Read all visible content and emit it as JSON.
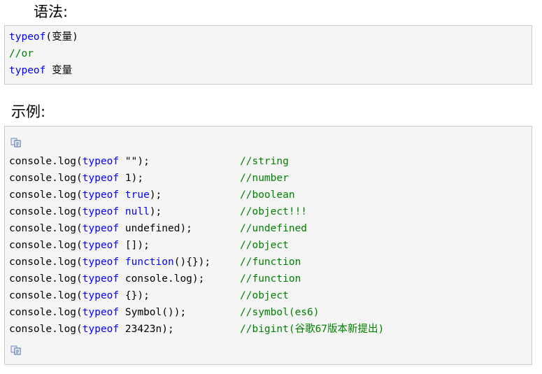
{
  "syntax": {
    "heading": "语法:",
    "lines": [
      [
        {
          "t": "typeof",
          "c": "kw"
        },
        {
          "t": "(变量)",
          "c": "pl"
        }
      ],
      [
        {
          "t": "//or",
          "c": "cm"
        }
      ],
      [
        {
          "t": "typeof",
          "c": "kw"
        },
        {
          "t": " 变量",
          "c": "pl"
        }
      ]
    ]
  },
  "example": {
    "heading": "示例:",
    "lines": [
      {
        "code": [
          {
            "t": "console.log(",
            "c": "pl"
          },
          {
            "t": "typeof",
            "c": "kw"
          },
          {
            "t": " \"\");",
            "c": "pl"
          }
        ],
        "comment": "//string"
      },
      {
        "code": [
          {
            "t": "console.log(",
            "c": "pl"
          },
          {
            "t": "typeof",
            "c": "kw"
          },
          {
            "t": " 1);",
            "c": "pl"
          }
        ],
        "comment": "//number"
      },
      {
        "code": [
          {
            "t": "console.log(",
            "c": "pl"
          },
          {
            "t": "typeof",
            "c": "kw"
          },
          {
            "t": " ",
            "c": "pl"
          },
          {
            "t": "true",
            "c": "kw"
          },
          {
            "t": ");",
            "c": "pl"
          }
        ],
        "comment": "//boolean"
      },
      {
        "code": [
          {
            "t": "console.log(",
            "c": "pl"
          },
          {
            "t": "typeof",
            "c": "kw"
          },
          {
            "t": " ",
            "c": "pl"
          },
          {
            "t": "null",
            "c": "kw"
          },
          {
            "t": ");",
            "c": "pl"
          }
        ],
        "comment": "//object!!!"
      },
      {
        "code": [
          {
            "t": "console.log(",
            "c": "pl"
          },
          {
            "t": "typeof",
            "c": "kw"
          },
          {
            "t": " undefined);",
            "c": "pl"
          }
        ],
        "comment": "//undefined"
      },
      {
        "code": [
          {
            "t": "console.log(",
            "c": "pl"
          },
          {
            "t": "typeof",
            "c": "kw"
          },
          {
            "t": " []);",
            "c": "pl"
          }
        ],
        "comment": "//object"
      },
      {
        "code": [
          {
            "t": "console.log(",
            "c": "pl"
          },
          {
            "t": "typeof",
            "c": "kw"
          },
          {
            "t": " ",
            "c": "pl"
          },
          {
            "t": "function",
            "c": "kw"
          },
          {
            "t": "(){});",
            "c": "pl"
          }
        ],
        "comment": "//function"
      },
      {
        "code": [
          {
            "t": "console.log(",
            "c": "pl"
          },
          {
            "t": "typeof",
            "c": "kw"
          },
          {
            "t": " console.log);",
            "c": "pl"
          }
        ],
        "comment": "//function"
      },
      {
        "code": [
          {
            "t": "console.log(",
            "c": "pl"
          },
          {
            "t": "typeof",
            "c": "kw"
          },
          {
            "t": " {});",
            "c": "pl"
          }
        ],
        "comment": "//object"
      },
      {
        "code": [
          {
            "t": "console.log(",
            "c": "pl"
          },
          {
            "t": "typeof",
            "c": "kw"
          },
          {
            "t": " Symbol());",
            "c": "pl"
          }
        ],
        "comment": "//symbol(es6)"
      },
      {
        "code": [
          {
            "t": "console.log(",
            "c": "pl"
          },
          {
            "t": "typeof",
            "c": "kw"
          },
          {
            "t": " 23423n);",
            "c": "pl"
          }
        ],
        "comment": "//bigint(谷歌67版本新提出)"
      }
    ]
  },
  "icons": {
    "copy": "copy-code-icon"
  },
  "colors": {
    "keyword": "#0000ff",
    "comment": "#008000",
    "box_bg": "#f5f5f5",
    "box_border": "#cccccc"
  }
}
